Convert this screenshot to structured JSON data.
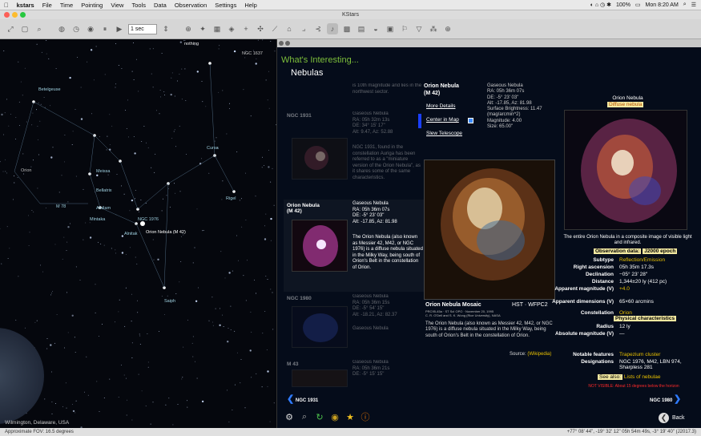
{
  "menubar": {
    "apple": "",
    "app": "kstars",
    "items": [
      "File",
      "Time",
      "Pointing",
      "View",
      "Tools",
      "Data",
      "Observation",
      "Settings",
      "Help"
    ],
    "battery": "100%",
    "clock": "Mon 8:20 AM"
  },
  "window": {
    "title": "KStars"
  },
  "toolbar": {
    "timestep": "1 sec"
  },
  "skymap": {
    "top_label": "nothing",
    "corner_label": "NGC 1637",
    "location": "Wilmington, Delaware, USA",
    "labels": [
      "Betelgeuse",
      "Orion",
      "Meissa",
      "Bellatrix",
      "M 78",
      "Alnilam",
      "Mintaka",
      "Alnitak",
      "Orion Nebula (M 42)",
      "NGC 1976",
      "Rigel",
      "Saiph",
      "Cursa"
    ]
  },
  "statusbar": {
    "fov": "Approximate FOV: 16.5 degrees",
    "coords": "+77° 08' 44\", -19° 32' 12\"  05h 54m 49s, -3° 19' 40\" (J2017.3)"
  },
  "panel": {
    "heading": "What's Interesting...",
    "category": "Nebulas",
    "intro_text": "is 10th magnitude and lies in the northwest sector.",
    "objects": [
      {
        "name": "NGC 1931",
        "info": "Gaseous Nebula\nRA: 05h 32m 13s\nDE: 34° 15' 17\"\nAlt: 9.47, Az: 52.88",
        "desc": "NGC 1931, found in the constellation Auriga has been referred to as a \"miniature version of the Orion Nebula\", as it shares some of the same characteristics."
      },
      {
        "name": "Orion Nebula\n(M 42)",
        "info": "Gaseous Nebula\nRA: 05h 36m 07s\nDE: -5° 23' 03\"\nAlt: -17.85, Az: 81.98",
        "desc": "The Orion Nebula (also known as Messier 42, M42, or NGC 1976) is a diffuse nebula situated in the Milky Way, being south of Orion's Belt in the constellation of Orion."
      },
      {
        "name": "NGC 1980",
        "info": "Gaseous Nebula\nRA: 05h 36m 15s\nDE: -5° 54' 15\"\nAlt: -18.21, Az: 82.37",
        "desc": "Gaseous Nebula"
      },
      {
        "name": "M 43",
        "info": "Gaseous Nebula\nRA: 05h 36m 21s\nDE: -5° 15' 15\"",
        "desc": ""
      }
    ],
    "detail": {
      "title": "Orion Nebula\n(M 42)",
      "info": "Gaseous Nebula\nRA: 05h 36m 07s\nDE: -5° 23' 03\"\nAlt: -17.85, Az: 81.98\nSurface Brightness: 11.47\n(mag/arcmin^2)\nMagnitude: 4.00\nSize: 65.00\"",
      "links": [
        "More Details",
        "Center in Map",
        "Slew Telescope"
      ],
      "mosaic_title": "Orion Nebula Mosaic",
      "mosaic_hst": "HST · WFPC2",
      "mosaic_credit": "PRC95-45a · ST ScI OPO · November 20, 1995\nC. R. O'Dell and S. K. Wong (Rice University), NASA",
      "mosaic_desc": "The Orion Nebula (also known as Messier 42, M42, or NGC 1976) is a diffuse nebula situated in the Milky Way, being south of Orion's Belt in the constellation of Orion.",
      "source_label": "Source:",
      "source_link": "(Wikipedia)"
    },
    "wiki": {
      "title": "Orion Nebula",
      "type": "Diffuse nebula",
      "caption": "The entire Orion Nebula in a composite image of visible light and infrared.",
      "obs_label": "Observation data:",
      "obs_value": "J2000 epoch",
      "rows": [
        {
          "k": "Subtype",
          "v": "Reflection/Emission"
        },
        {
          "k": "Right ascension",
          "v": "05h 35m 17.3s"
        },
        {
          "k": "Declination",
          "v": "−05° 23′ 28″"
        },
        {
          "k": "Distance",
          "v": "1,344±20 ly  (412 pc)"
        },
        {
          "k": "Apparent magnitude (V)",
          "v": "+4.0"
        },
        {
          "k": "Apparent dimensions (V)",
          "v": "65×60 arcmins"
        },
        {
          "k": "Constellation",
          "v": "Orion"
        }
      ],
      "phys_label": "Physical characteristics",
      "rows2": [
        {
          "k": "Radius",
          "v": "12 ly"
        },
        {
          "k": "Absolute magnitude (V)",
          "v": "—"
        }
      ],
      "rows3": [
        {
          "k": "Notable features",
          "v": "Trapezium cluster"
        },
        {
          "k": "Designations",
          "v": "NGC 1976, M42, LBN 974, Sharpless 281"
        }
      ],
      "see_also_label": "See also:",
      "see_also_link": "Lists of nebulae",
      "not_visible": "NOT VISIBLE: About 15 degrees below the horizon"
    },
    "nav": {
      "prev": "NGC 1931",
      "next": "NGC 1980",
      "back": "Back"
    }
  }
}
